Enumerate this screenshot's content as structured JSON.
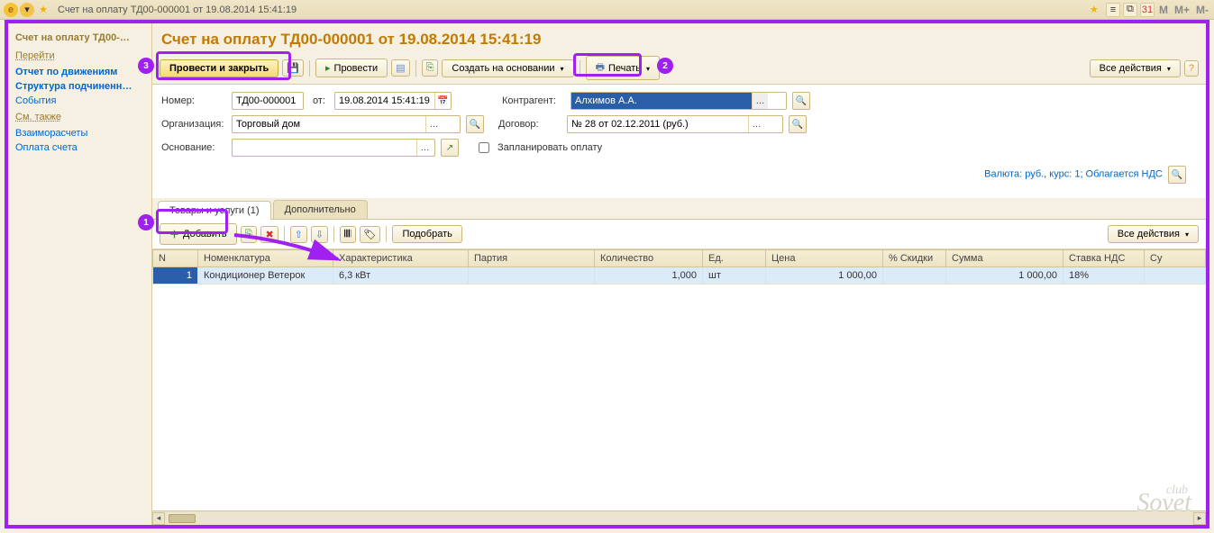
{
  "titlebar": {
    "title": "Счет на оплату ТД00-000001 от 19.08.2014 15:41:19",
    "m1": "M",
    "m2": "M+",
    "m3": "M-"
  },
  "sidebar": {
    "title": "Счет на оплату ТД00-…",
    "section_go": "Перейти",
    "link_report": "Отчет по движениям",
    "link_struct": "Структура подчиненн…",
    "link_events": "События",
    "section_see": "См. также",
    "link_vzaim": "Взаиморасчеты",
    "link_oplata": "Оплата счета"
  },
  "doc": {
    "title": "Счет на оплату ТД00-000001 от 19.08.2014 15:41:19"
  },
  "toolbar": {
    "post_close": "Провести и закрыть",
    "post": "Провести",
    "create_based": "Создать на основании",
    "print": "Печать",
    "all_actions": "Все действия"
  },
  "form": {
    "lbl_number": "Номер:",
    "number": "ТД00-000001",
    "lbl_from": "от:",
    "date": "19.08.2014 15:41:19",
    "lbl_org": "Организация:",
    "org": "Торговый дом",
    "lbl_base": "Основание:",
    "base": "",
    "lbl_contr": "Контрагент:",
    "contr": "Алхимов А.А.",
    "lbl_dogovor": "Договор:",
    "dogovor": "№ 28 от 02.12.2011 (руб.)",
    "lbl_plan": "Запланировать оплату"
  },
  "info": {
    "text": "Валюта: руб., курс: 1; Облагается НДС"
  },
  "tabs": {
    "goods": "Товары и услуги (1)",
    "addl": "Дополнительно"
  },
  "subtoolbar": {
    "add": "Добавить",
    "select": "Подобрать",
    "all_actions": "Все действия"
  },
  "grid": {
    "headers": {
      "n": "N",
      "nomen": "Номенклатура",
      "char": "Характеристика",
      "party": "Партия",
      "qty": "Количество",
      "unit": "Ед.",
      "price": "Цена",
      "disc": "% Скидки",
      "sum": "Сумма",
      "vat": "Ставка НДС",
      "su": "Су"
    },
    "rows": [
      {
        "n": "1",
        "nomen": "Кондиционер Ветерок",
        "char": "6,3 кВт",
        "party": "",
        "qty": "1,000",
        "unit": "шт",
        "price": "1 000,00",
        "disc": "",
        "sum": "1 000,00",
        "vat": "18%"
      }
    ]
  },
  "watermark": {
    "small": "club",
    "big": "Sovet"
  }
}
